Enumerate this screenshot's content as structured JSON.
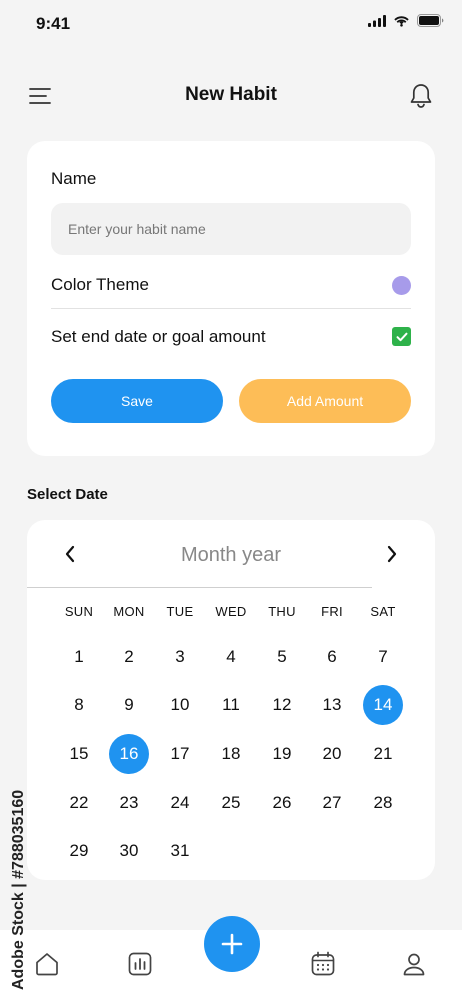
{
  "status": {
    "time": "9:41"
  },
  "header": {
    "title": "New Habit"
  },
  "form": {
    "name_label": "Name",
    "name_placeholder": "Enter your habit name",
    "color_theme_label": "Color Theme",
    "color_theme_value": "#a79bea",
    "end_date_label": "Set end date or goal amount",
    "end_date_checked": true,
    "save_label": "Save",
    "add_amount_label": "Add Amount"
  },
  "calendar": {
    "section_label": "Select Date",
    "title": "Month year",
    "weekdays": [
      "SUN",
      "MON",
      "TUE",
      "WED",
      "THU",
      "FRI",
      "SAT"
    ],
    "weeks": [
      [
        "1",
        "2",
        "3",
        "4",
        "5",
        "6",
        "7"
      ],
      [
        "8",
        "9",
        "10",
        "11",
        "12",
        "13",
        "14"
      ],
      [
        "15",
        "16",
        "17",
        "18",
        "19",
        "20",
        "21"
      ],
      [
        "22",
        "23",
        "24",
        "25",
        "26",
        "27",
        "28"
      ],
      [
        "29",
        "30",
        "31",
        "",
        "",
        "",
        ""
      ]
    ],
    "selected_days": [
      "14",
      "16"
    ]
  },
  "tabbar": {
    "items": [
      "home-icon",
      "stats-icon",
      "calendar-icon",
      "profile-icon"
    ]
  },
  "colors": {
    "accent": "#1f93f0",
    "secondary": "#fdbd57",
    "check": "#2eb24a"
  },
  "watermark": "Adobe Stock | #788035160"
}
